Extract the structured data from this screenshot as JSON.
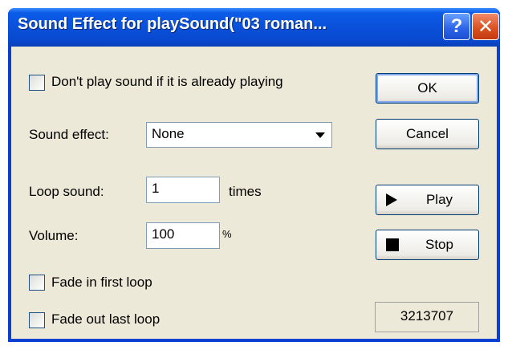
{
  "window": {
    "title": "Sound Effect for playSound(\"03 roman...",
    "help_glyph": "?",
    "close_glyph": "✕"
  },
  "options": {
    "dont_play_label": "Don't play sound if it is already playing",
    "dont_play_checked": false,
    "fade_in_label": "Fade in first loop",
    "fade_in_checked": false,
    "fade_out_label": "Fade out last loop",
    "fade_out_checked": false
  },
  "sound_effect": {
    "label": "Sound effect:",
    "selected": "None"
  },
  "loop": {
    "label": "Loop sound:",
    "value": "1",
    "unit": "times"
  },
  "volume": {
    "label": "Volume:",
    "value": "100",
    "unit": "%"
  },
  "buttons": {
    "ok": "OK",
    "cancel": "Cancel",
    "play": "Play",
    "stop": "Stop"
  },
  "counter": "3213707"
}
